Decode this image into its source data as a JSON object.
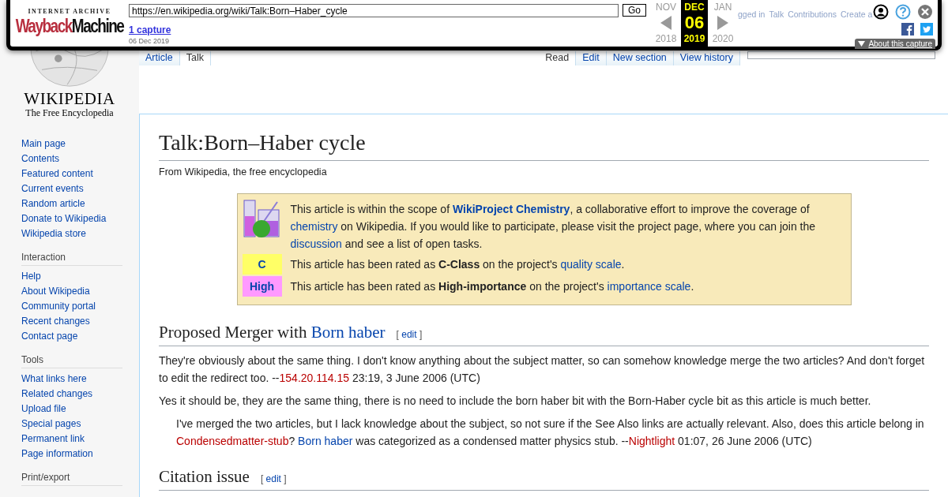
{
  "wayback": {
    "logo_top": "INTERNET ARCHIVE",
    "logo_word_1": "Wayback",
    "logo_word_2": "Machine",
    "url": "https://en.wikipedia.org/wiki/Talk:Born–Haber_cycle",
    "go": "Go",
    "captures": "1 capture",
    "capture_date": "06 Dec 2019",
    "months": [
      {
        "month": "NOV",
        "year": "2018",
        "selected": false
      },
      {
        "month": "DEC",
        "day": "06",
        "year": "2019",
        "selected": true
      },
      {
        "month": "JAN",
        "year": "2020",
        "selected": false
      }
    ],
    "about": "About this capture"
  },
  "personal_links": [
    "gged in",
    "Talk",
    "Contributions",
    "Create a"
  ],
  "logo": {
    "wordmark": "WIKIPEDIA",
    "tagline": "The Free Encyclopedia"
  },
  "left_tabs": [
    {
      "label": "Article",
      "selected": false
    },
    {
      "label": "Talk",
      "selected": true
    }
  ],
  "right_tabs": [
    {
      "label": "Read",
      "selected": true
    },
    {
      "label": "Edit",
      "selected": false
    },
    {
      "label": "New section",
      "selected": false
    },
    {
      "label": "View history",
      "selected": false
    }
  ],
  "sidebar": [
    {
      "items": [
        "Main page",
        "Contents",
        "Featured content",
        "Current events",
        "Random article",
        "Donate to Wikipedia",
        "Wikipedia store"
      ]
    },
    {
      "heading": "Interaction",
      "items": [
        "Help",
        "About Wikipedia",
        "Community portal",
        "Recent changes",
        "Contact page"
      ]
    },
    {
      "heading": "Tools",
      "items": [
        "What links here",
        "Related changes",
        "Upload file",
        "Special pages",
        "Permanent link",
        "Page information"
      ]
    },
    {
      "heading": "Print/export"
    }
  ],
  "title": "Talk:Born–Haber cycle",
  "subtitle": "From Wikipedia, the free encyclopedia",
  "banner": [
    {
      "kind": "icon",
      "segments": [
        {
          "kind": "text",
          "text": "This article is within the scope of "
        },
        {
          "kind": "boldlink",
          "text": "WikiProject Chemistry"
        },
        {
          "kind": "text",
          "text": ", a collaborative effort to improve the coverage of "
        },
        {
          "kind": "link",
          "text": "chemistry"
        },
        {
          "kind": "text",
          "text": " on Wikipedia. If you would like to participate, please visit the project page, where you can join the "
        },
        {
          "kind": "link",
          "text": "discussion"
        },
        {
          "kind": "text",
          "text": " and see a list of open tasks."
        }
      ]
    },
    {
      "kind": "badge",
      "badge": "C",
      "color": "#ffff66",
      "segments": [
        {
          "kind": "text",
          "text": "This article has been rated as "
        },
        {
          "kind": "bold",
          "text": "C-Class"
        },
        {
          "kind": "text",
          "text": " on the project's "
        },
        {
          "kind": "link",
          "text": "quality scale"
        },
        {
          "kind": "text",
          "text": "."
        }
      ]
    },
    {
      "kind": "badge",
      "badge": "High",
      "color": "#ff99ff",
      "segments": [
        {
          "kind": "text",
          "text": "This article has been rated as "
        },
        {
          "kind": "bold",
          "text": "High-importance"
        },
        {
          "kind": "text",
          "text": " on the project's "
        },
        {
          "kind": "link",
          "text": "importance scale"
        },
        {
          "kind": "text",
          "text": "."
        }
      ]
    }
  ],
  "sections": [
    {
      "heading": [
        {
          "kind": "text",
          "text": "Proposed Merger with "
        },
        {
          "kind": "link",
          "text": "Born haber"
        }
      ],
      "edit_open": "[",
      "edit": "edit",
      "edit_close": "]",
      "paragraphs": [
        {
          "indented": false,
          "segments": [
            {
              "kind": "text",
              "text": "They're obviously about the same thing. I don't know anything about the subject matter, so can somehow knowledge merge the two articles? And don't forget to edit the redirect too. --"
            },
            {
              "kind": "redlink",
              "text": "154.20.114.15"
            },
            {
              "kind": "text",
              "text": " 23:19, 3 June 2006 (UTC)"
            }
          ]
        },
        {
          "indented": false,
          "segments": [
            {
              "kind": "text",
              "text": "Yes it should be, they are the same thing, there is no need to include the born haber bit with the Born-Haber cycle bit as this article is much better."
            }
          ]
        },
        {
          "indented": true,
          "segments": [
            {
              "kind": "text",
              "text": "I've merged the two articles, but I lack knowledge about the subject, so not sure if the See Also links are actually relevant. Also, does this article belong in "
            },
            {
              "kind": "redlink",
              "text": "Condensedmatter-stub"
            },
            {
              "kind": "text",
              "text": "? "
            },
            {
              "kind": "link",
              "text": "Born haber"
            },
            {
              "kind": "text",
              "text": " was categorized as a condensed matter physics stub. --"
            },
            {
              "kind": "redlink",
              "text": "Nightlight"
            },
            {
              "kind": "text",
              "text": " 01:07, 26 June 2006 (UTC)"
            }
          ]
        }
      ]
    },
    {
      "heading": [
        {
          "kind": "text",
          "text": "Citation issue"
        }
      ],
      "edit_open": "[",
      "edit": "edit",
      "edit_close": "]"
    }
  ]
}
